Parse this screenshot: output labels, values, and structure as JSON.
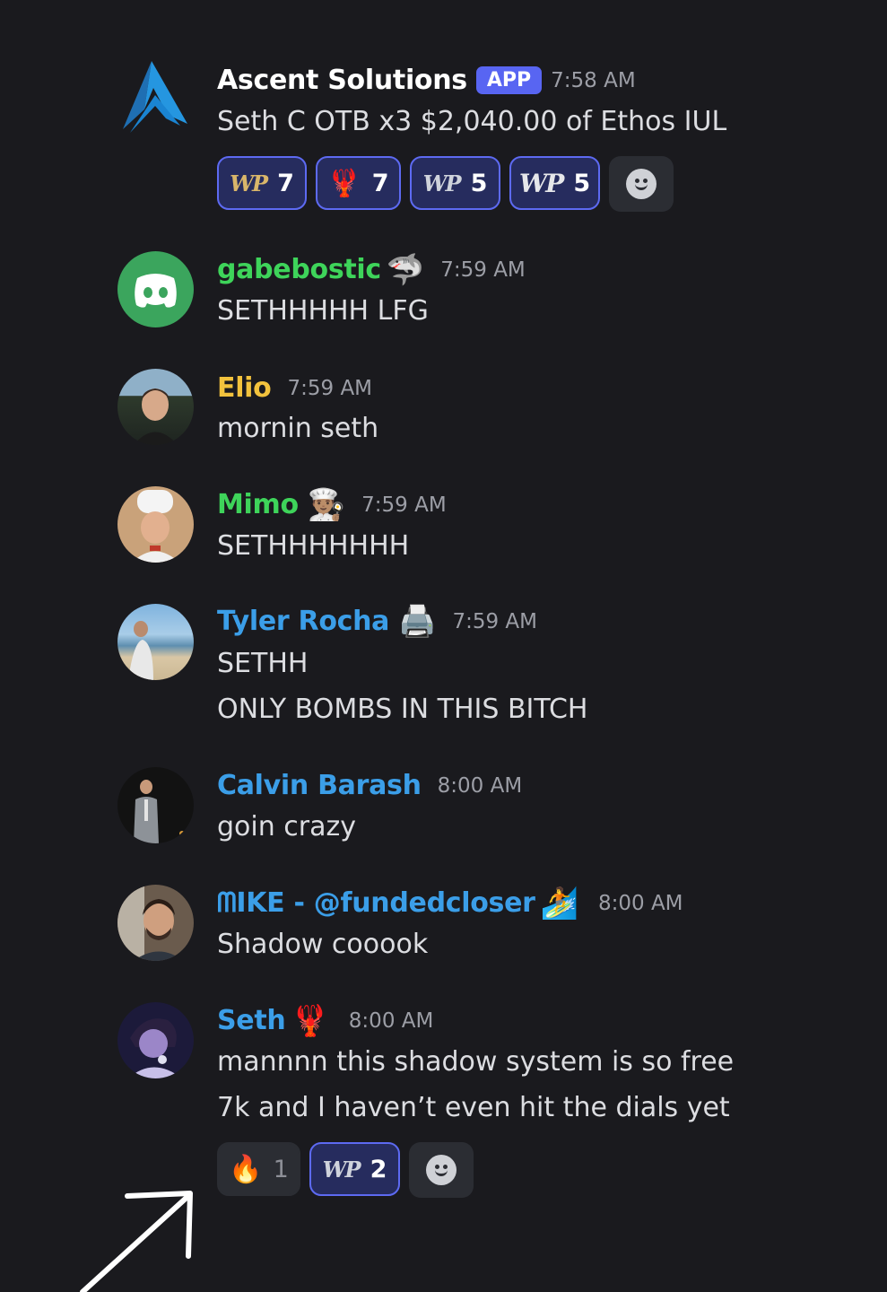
{
  "colors": {
    "background": "#1a1a1e",
    "green_name": "#3ed45a",
    "yellow_name": "#f2c23d",
    "blue_name": "#3b9ee8",
    "app_badge": "#5865f2",
    "reaction_active_border": "#5d6af2"
  },
  "messages": [
    {
      "author": "Ascent Solutions",
      "badge": "APP",
      "time": "7:58 AM",
      "lines": [
        "Seth C OTB x3 $2,040.00 of Ethos IUL"
      ],
      "reactions": [
        {
          "icon": "wp-logo",
          "label": "WP",
          "count": "7"
        },
        {
          "icon": "lobster-icon",
          "label": "🦞",
          "count": "7"
        },
        {
          "icon": "wp-logo",
          "label": "WP",
          "count": "5"
        },
        {
          "icon": "wp-logo",
          "label": "WP",
          "count": "5"
        }
      ]
    },
    {
      "author": "gabebostic",
      "emoji": "🦈",
      "time": "7:59 AM",
      "lines": [
        "SETHHHHH LFG"
      ]
    },
    {
      "author": "Elio",
      "time": "7:59 AM",
      "lines": [
        "mornin seth"
      ]
    },
    {
      "author": "Mimo",
      "emoji": "👨🏽‍🍳",
      "time": "7:59 AM",
      "lines": [
        "SETHHHHHHH"
      ]
    },
    {
      "author": "Tyler Rocha",
      "emoji": "🖨️",
      "time": "7:59 AM",
      "lines": [
        "SETHH",
        "ONLY BOMBS IN THIS BITCH"
      ]
    },
    {
      "author": "Calvin Barash",
      "time": "8:00 AM",
      "lines": [
        "goin crazy"
      ]
    },
    {
      "author": "ᗰIKE - @fundedcloser",
      "emoji": "🏄",
      "time": "8:00 AM",
      "lines": [
        "Shadow cooook"
      ]
    },
    {
      "author": "Seth",
      "emoji": "🦞",
      "time": "8:00 AM",
      "lines": [
        "mannnn this shadow system is so free",
        "7k and I haven’t even hit the dials yet"
      ],
      "reactions": [
        {
          "icon": "fire-icon",
          "label": "🔥",
          "count": "1"
        },
        {
          "icon": "wp-logo",
          "label": "WP",
          "count": "2"
        }
      ]
    }
  ]
}
